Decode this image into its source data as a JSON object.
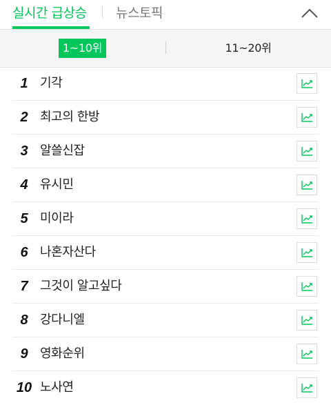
{
  "tabs": {
    "active_label": "실시간 급상승",
    "inactive_label": "뉴스토픽"
  },
  "range_toggle": {
    "active_label": "1~10위",
    "inactive_label": "11~20위"
  },
  "ranking": [
    {
      "rank": "1",
      "keyword": "기각"
    },
    {
      "rank": "2",
      "keyword": "최고의 한방"
    },
    {
      "rank": "3",
      "keyword": "알쓸신잡"
    },
    {
      "rank": "4",
      "keyword": "유시민"
    },
    {
      "rank": "5",
      "keyword": "미이라"
    },
    {
      "rank": "6",
      "keyword": "나혼자산다"
    },
    {
      "rank": "7",
      "keyword": "그것이 알고싶다"
    },
    {
      "rank": "8",
      "keyword": "강다니엘"
    },
    {
      "rank": "9",
      "keyword": "영화순위"
    },
    {
      "rank": "10",
      "keyword": "노사연"
    }
  ],
  "icons": {
    "collapse": "chevron-up-icon",
    "trend": "trend-chart-icon"
  },
  "colors": {
    "accent": "#03c75a",
    "trend_icon": "#03c75a"
  }
}
